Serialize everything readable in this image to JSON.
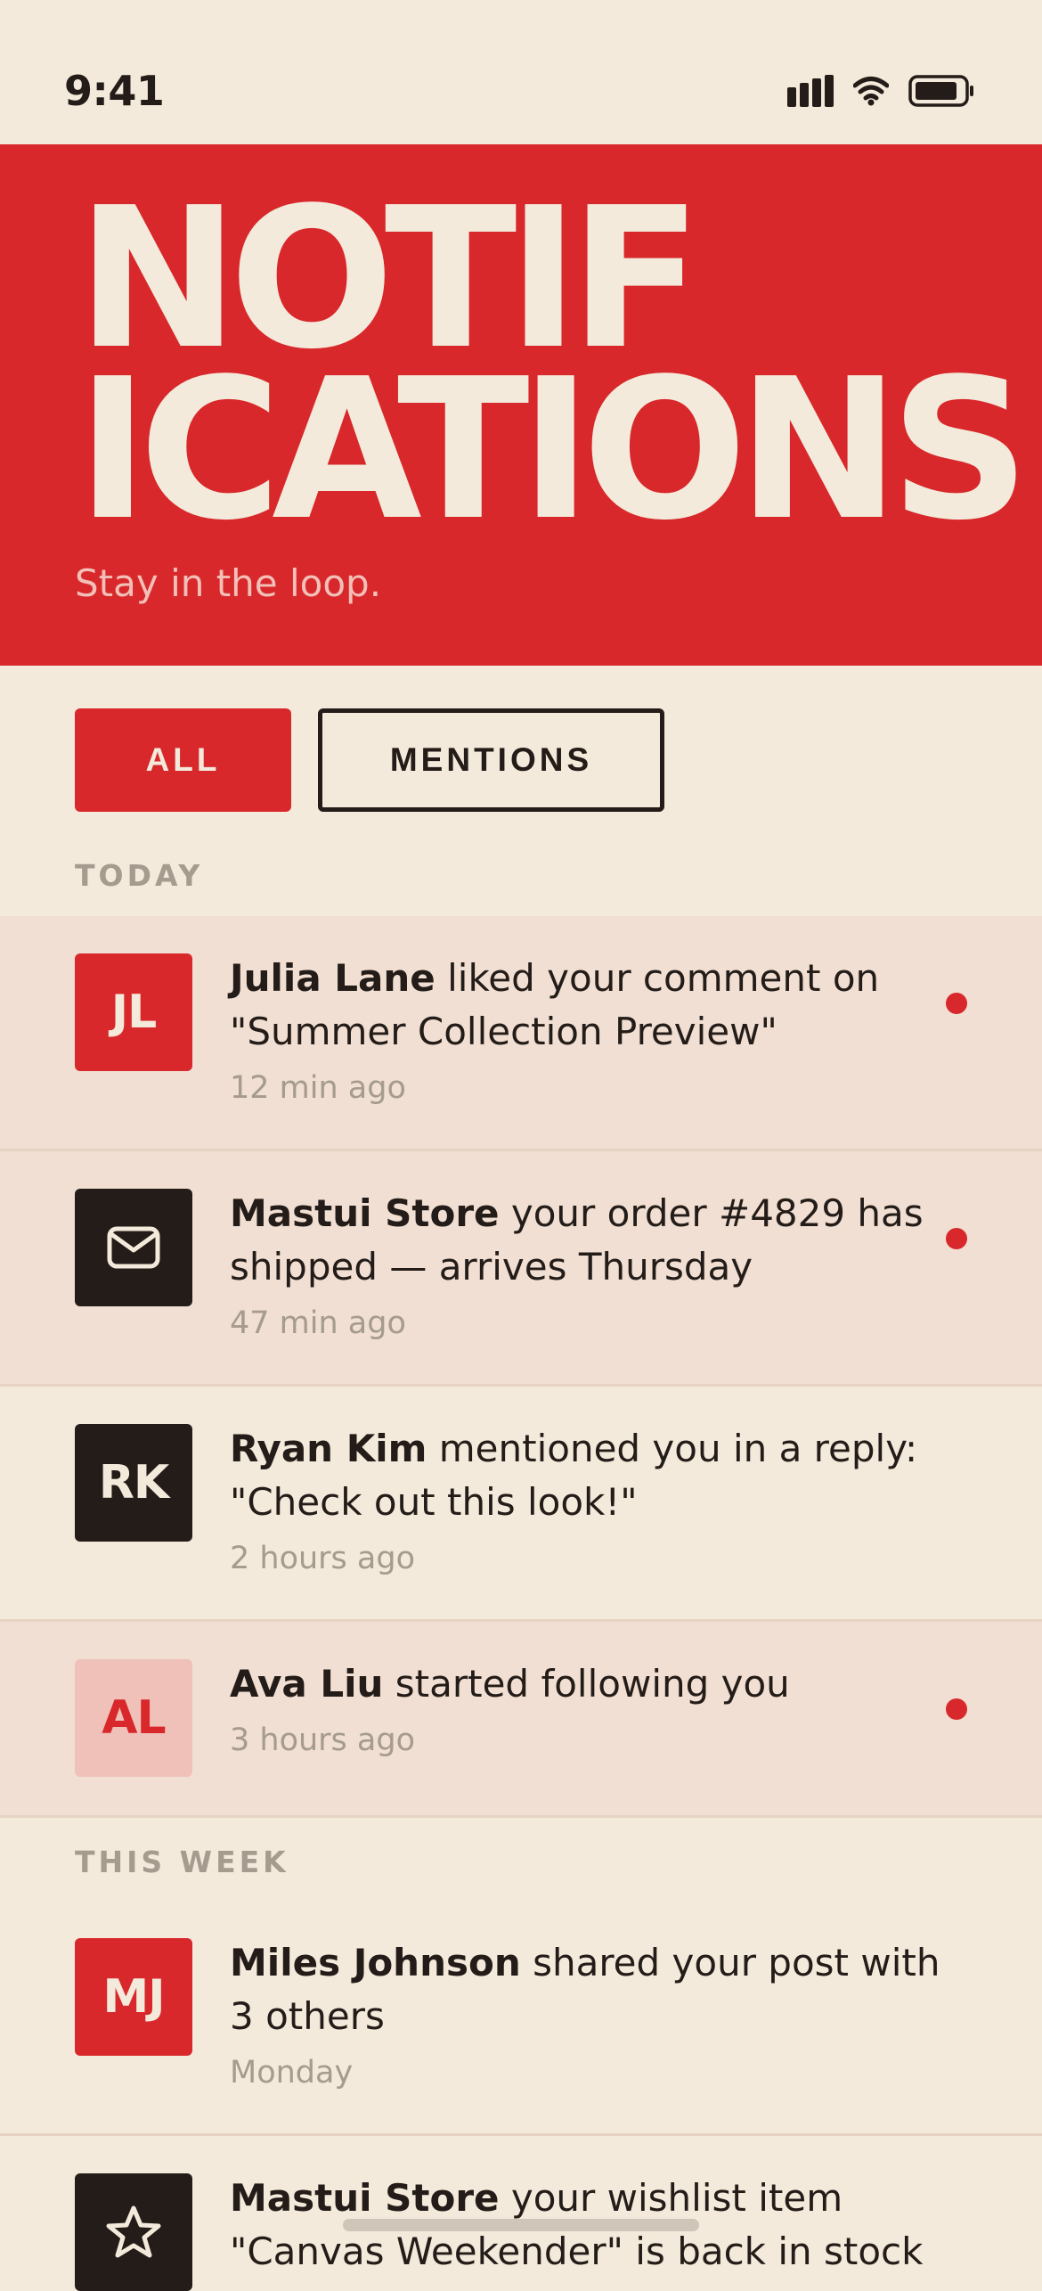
{
  "status_bar": {
    "time": "9:41"
  },
  "header": {
    "title": "NOTIF\nICATIONS",
    "subtitle": "Stay in the loop."
  },
  "filters": {
    "all_label": "ALL",
    "mentions_label": "MENTIONS",
    "selected": "ALL"
  },
  "sections": {
    "today_label": "TODAY",
    "this_week_label": "THIS WEEK"
  },
  "notifications": [
    {
      "avatar_text": "JL",
      "actor": "Julia Lane",
      "message": " liked your comment on \"Summer Collection Preview\"",
      "time": "12 min ago",
      "unread": true
    },
    {
      "avatar_icon": "mail-icon",
      "actor": "Mastui Store",
      "message": " your order #4829 has shipped — arrives Thursday",
      "time": "47 min ago",
      "unread": true
    },
    {
      "avatar_text": "RK",
      "actor": "Ryan Kim",
      "message": " mentioned you in a reply: \"Check out this look!\"",
      "time": "2 hours ago",
      "unread": false
    },
    {
      "avatar_text": "AL",
      "actor": "Ava Liu",
      "message": " started following you",
      "time": "3 hours ago",
      "unread": true
    },
    {
      "avatar_text": "MJ",
      "actor": "Miles Johnson",
      "message": " shared your post with 3 others",
      "time": "Monday",
      "unread": false
    },
    {
      "avatar_icon": "star-icon",
      "actor": "Mastui Store",
      "message": " your wishlist item \"Canvas Weekender\" is back in stock",
      "unread": false
    }
  ],
  "colors": {
    "accent": "#d8282b",
    "background": "#f3eadb",
    "unread_background": "#f0dfd2",
    "dark": "#241c18",
    "muted": "#a59b8e"
  }
}
